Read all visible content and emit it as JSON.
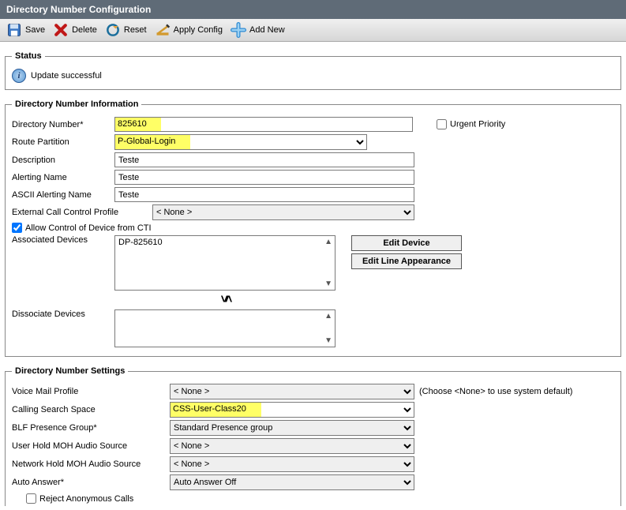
{
  "header": {
    "title": "Directory Number Configuration"
  },
  "toolbar": {
    "save": "Save",
    "delete": "Delete",
    "reset": "Reset",
    "apply": "Apply Config",
    "addnew": "Add New"
  },
  "status": {
    "legend": "Status",
    "message": "Update successful"
  },
  "dn_info": {
    "legend": "Directory Number Information",
    "dn_label": "Directory Number",
    "dn_value": "825610",
    "urgent_label": "Urgent Priority",
    "route_partition_label": "Route Partition",
    "route_partition_value": "P-Global-Login",
    "description_label": "Description",
    "description_value": "Teste",
    "alerting_label": "Alerting Name",
    "alerting_value": "Teste",
    "ascii_alerting_label": "ASCII Alerting Name",
    "ascii_alerting_value": "Teste",
    "ext_call_profile_label": "External Call Control Profile",
    "ext_call_profile_value": "< None >",
    "allow_cti_label": "Allow Control of Device from CTI",
    "assoc_devices_label": "Associated Devices",
    "assoc_device_value": "DP-825610",
    "edit_device": "Edit Device",
    "edit_line": "Edit Line Appearance",
    "dissoc_label": "Dissociate Devices"
  },
  "dn_settings": {
    "legend": "Directory Number Settings",
    "vm_profile_label": "Voice Mail Profile",
    "vm_profile_value": "< None >",
    "vm_hint": "(Choose <None> to use system default)",
    "css_label": "Calling Search Space",
    "css_value": "CSS-User-Class20",
    "blf_label": "BLF Presence Group",
    "blf_value": "Standard Presence group",
    "user_hold_label": "User Hold MOH Audio Source",
    "user_hold_value": "< None >",
    "net_hold_label": "Network Hold MOH Audio Source",
    "net_hold_value": "< None >",
    "auto_answer_label": "Auto Answer",
    "auto_answer_value": "Auto Answer Off",
    "reject_anon_label": "Reject Anonymous Calls"
  }
}
